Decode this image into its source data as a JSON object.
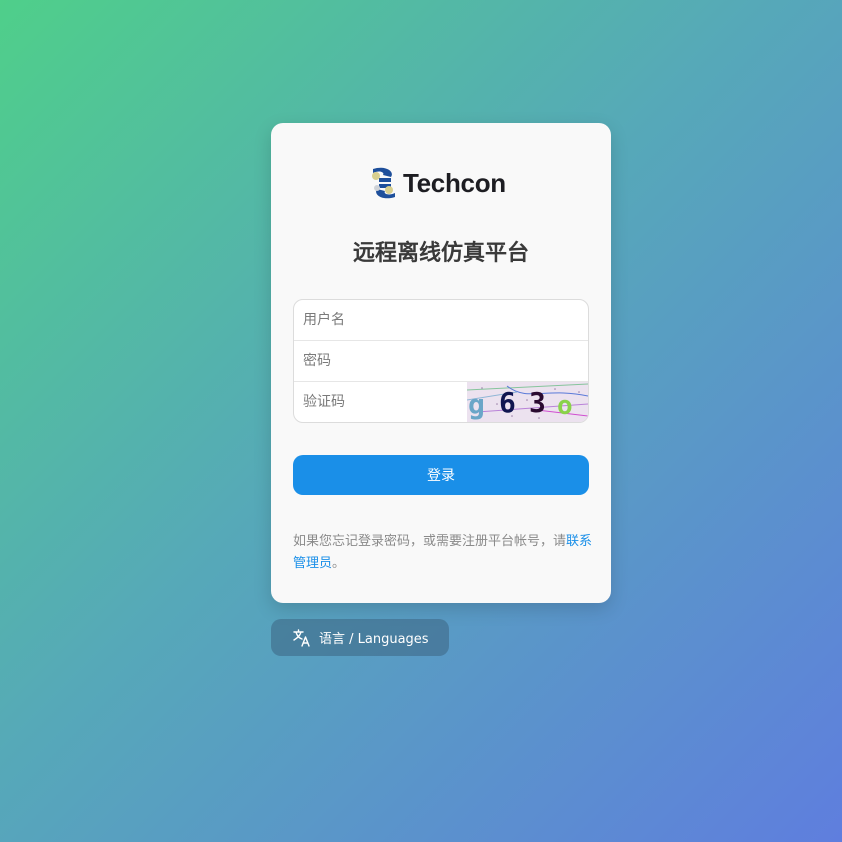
{
  "brand": {
    "logo_text": "Techcon"
  },
  "title": "远程离线仿真平台",
  "form": {
    "username_placeholder": "用户名",
    "password_placeholder": "密码",
    "captcha_placeholder": "验证码",
    "captcha_code": "g63o"
  },
  "login_button": "登录",
  "note": {
    "text": "如果您忘记登录密码，或需要注册平台帐号，请",
    "link": "联系管理员",
    "suffix": "。"
  },
  "language_button": {
    "icon": "translate-icon",
    "label": "语言 / Languages"
  },
  "colors": {
    "primary": "#1a8fe8",
    "bg_gradient_start": "#4fcf8a",
    "bg_gradient_end": "#5f7ede"
  }
}
